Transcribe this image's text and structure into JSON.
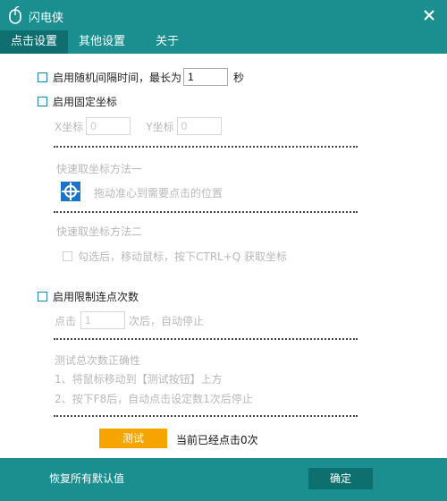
{
  "window": {
    "title": "闪电侠",
    "tabs": [
      {
        "label": "点击设置"
      },
      {
        "label": "其他设置"
      },
      {
        "label": "关于"
      }
    ]
  },
  "random_interval": {
    "label": "启用随机间隔时间，最长为",
    "value": "1",
    "unit": "秒"
  },
  "fixed_coordinate": {
    "label": "启用固定坐标",
    "x_label": "X坐标",
    "x_value": "0",
    "y_label": "Y坐标",
    "y_value": "0",
    "method1_title": "快速取坐标方法一",
    "method1_hint": "拖动准心到需要点击的位置",
    "method2_title": "快速取坐标方法二",
    "method2_checkbox_label": "勾选后，移动鼠标，按下CTRL+Q 获取坐标"
  },
  "limit_clicks": {
    "label": "启用限制连点次数",
    "prefix": "点击",
    "value": "1",
    "suffix": "次后，自动停止"
  },
  "test_correctness": {
    "title": "测试总次数正确性",
    "step1": "1、将鼠标移动到【测试按钮】上方",
    "step2": "2、按下F8后，自动点击设定数1次后停止",
    "test_button": "测试",
    "status": "当前已经点击0次"
  },
  "footer": {
    "restore_defaults": "恢复所有默认值",
    "confirm": "确定"
  },
  "colors": {
    "accent": "#1b8f8f",
    "tab_active": "#0f6f70",
    "test_button": "#f5a400",
    "checkbox_border": "#1e83b8"
  }
}
